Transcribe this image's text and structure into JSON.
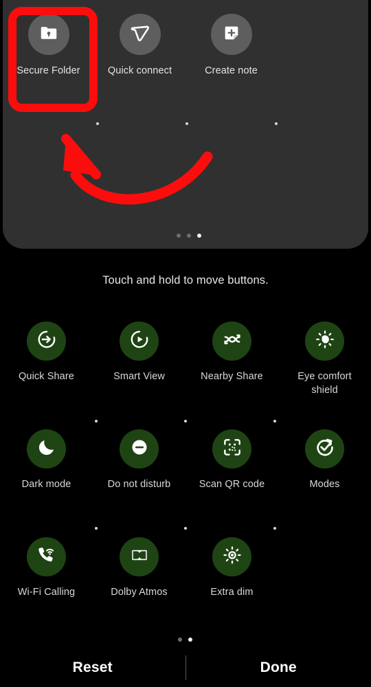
{
  "panel": {
    "top_shortcuts": [
      {
        "label": "Secure Folder",
        "icon": "secure-folder-icon",
        "highlighted": true
      },
      {
        "label": "Quick connect",
        "icon": "quick-connect-icon",
        "highlighted": false
      },
      {
        "label": "Create note",
        "icon": "create-note-icon",
        "highlighted": false
      }
    ],
    "page_dots": {
      "count": 3,
      "active_index": 2
    }
  },
  "hint": {
    "text": "Touch and hold to move buttons."
  },
  "quick_settings": {
    "rows": [
      [
        {
          "label": "Quick Share",
          "icon": "quick-share-icon"
        },
        {
          "label": "Smart View",
          "icon": "smart-view-icon"
        },
        {
          "label": "Nearby Share",
          "icon": "nearby-share-icon"
        },
        {
          "label": "Eye comfort shield",
          "icon": "eye-comfort-shield-icon"
        }
      ],
      [
        {
          "label": "Dark mode",
          "icon": "dark-mode-icon"
        },
        {
          "label": "Do not disturb",
          "icon": "do-not-disturb-icon"
        },
        {
          "label": "Scan QR code",
          "icon": "scan-qr-code-icon"
        },
        {
          "label": "Modes",
          "icon": "modes-icon"
        }
      ],
      [
        {
          "label": "Wi-Fi Calling",
          "icon": "wifi-calling-icon"
        },
        {
          "label": "Dolby Atmos",
          "icon": "dolby-atmos-icon"
        },
        {
          "label": "Extra dim",
          "icon": "extra-dim-icon"
        }
      ]
    ],
    "page_dots": {
      "count": 2,
      "active_index": 1
    }
  },
  "bottom_bar": {
    "reset_label": "Reset",
    "done_label": "Done"
  },
  "annotations": {
    "highlight_target": "Secure Folder",
    "arrow": "curved-arrow-pointing-to-secure-folder"
  },
  "colors": {
    "background": "#000000",
    "panel_background": "#303030",
    "tile_active_green": "#1f4414",
    "shortcut_circle_gray": "#5e5e5e",
    "annotation_red": "#fc0d0d",
    "text_primary": "#e8e8e8"
  }
}
